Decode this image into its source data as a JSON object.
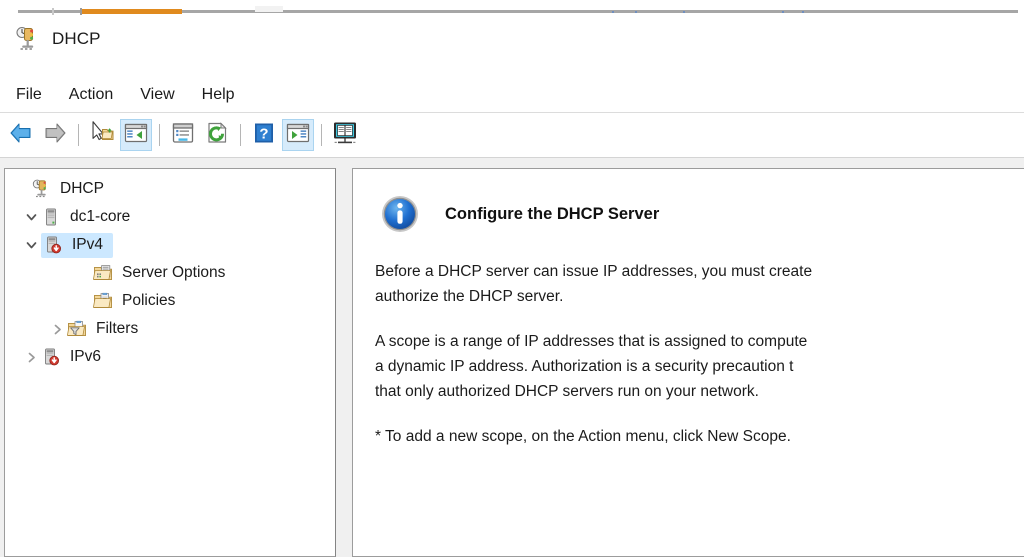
{
  "window": {
    "title": "DHCP",
    "app_icon": "dhcp-icon"
  },
  "top_strip": {
    "active_tab_accent": "#e08a1e",
    "rail_color": "#a6a6a6"
  },
  "menubar": {
    "items": [
      {
        "label": "File",
        "name": "menu-file"
      },
      {
        "label": "Action",
        "name": "menu-action"
      },
      {
        "label": "View",
        "name": "menu-view"
      },
      {
        "label": "Help",
        "name": "menu-help"
      }
    ]
  },
  "toolbar": {
    "buttons": [
      {
        "icon": "back-arrow-icon",
        "tooltip": "Back",
        "checked": false
      },
      {
        "icon": "forward-arrow-icon",
        "tooltip": "Forward",
        "checked": false
      },
      {
        "icon": "up-one-level-icon",
        "tooltip": "Up One Level",
        "checked": false
      },
      {
        "icon": "show-console-tree-icon",
        "tooltip": "Show/Hide Console Tree",
        "checked": true
      },
      {
        "icon": "properties-icon",
        "tooltip": "Properties",
        "checked": false
      },
      {
        "icon": "refresh-icon",
        "tooltip": "Refresh",
        "checked": false
      },
      {
        "icon": "help-icon",
        "tooltip": "Help",
        "checked": false
      },
      {
        "icon": "show-action-pane-icon",
        "tooltip": "Show/Hide Action Pane",
        "checked": true
      },
      {
        "icon": "export-list-icon",
        "tooltip": "Export List",
        "checked": false
      }
    ]
  },
  "tree": {
    "nodes": [
      {
        "label": "DHCP",
        "icon": "dhcp-icon",
        "indent": 0,
        "twisty": "none",
        "selected": false
      },
      {
        "label": "dc1-core",
        "icon": "server-icon",
        "indent": 1,
        "twisty": "expanded",
        "selected": false
      },
      {
        "label": "IPv4",
        "icon": "ipv4-server-icon",
        "indent": 2,
        "twisty": "expanded",
        "selected": true
      },
      {
        "label": "Server Options",
        "icon": "server-options-icon",
        "indent": 3,
        "twisty": "none",
        "selected": false
      },
      {
        "label": "Policies",
        "icon": "policies-icon",
        "indent": 3,
        "twisty": "none",
        "selected": false
      },
      {
        "label": "Filters",
        "icon": "filters-icon",
        "indent": 3,
        "twisty": "collapsed",
        "selected": false
      },
      {
        "label": "IPv6",
        "icon": "ipv6-server-icon",
        "indent": 2,
        "twisty": "collapsed",
        "selected": false
      }
    ],
    "selection_color": "#cce8ff"
  },
  "content": {
    "icon": "info-icon",
    "title": "Configure the DHCP Server",
    "paragraphs": [
      "Before a DHCP server can issue IP addresses, you must create",
      "authorize the DHCP server.",
      "A scope is a range of IP addresses that is assigned to compute",
      "a dynamic IP address. Authorization is a security precaution t",
      "that only authorized DHCP servers run on your network.",
      "* To add a new scope, on the Action menu, click New Scope."
    ]
  }
}
